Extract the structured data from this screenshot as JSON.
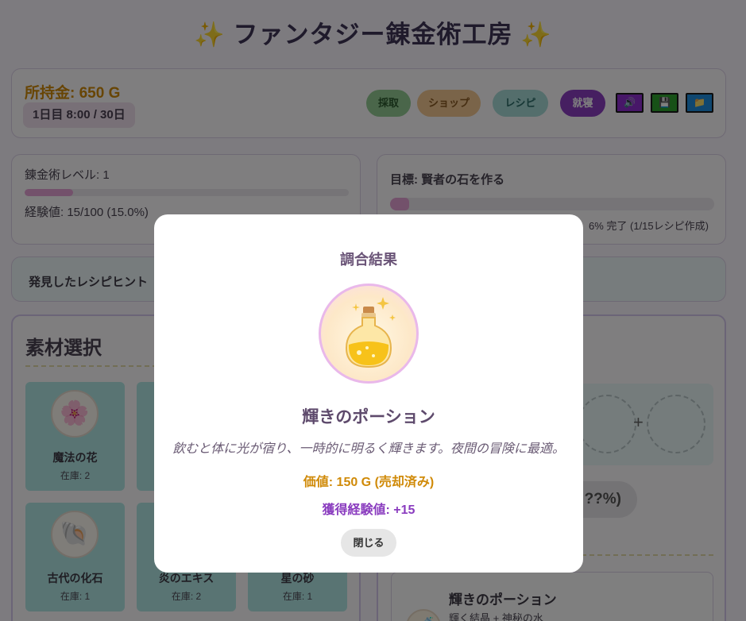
{
  "header": {
    "title": "ファンタジー錬金術工房",
    "sparkle": "✨"
  },
  "status": {
    "gold": "所持金: 650 G",
    "day": "1日目 8:00 / 30日"
  },
  "nav": {
    "gather": "採取",
    "shop": "ショップ",
    "recipe": "レシピ",
    "sleep": "就寝"
  },
  "toolbar": {
    "sound_icon": "speaker-icon",
    "save_icon": "floppy-disk-icon",
    "load_icon": "folder-icon",
    "sound_glyph": "🔊",
    "save_glyph": "💾",
    "load_glyph": "📁"
  },
  "level": {
    "label": "錬金術レベル: 1",
    "exp": "経験値: 15/100 (15.0%)",
    "exp_fraction": 0.15
  },
  "goal": {
    "label": "目標: 賢者の石を作る",
    "progress": "6% 完了 (1/15レシピ作成)",
    "progress_fraction": 0.06
  },
  "hints": {
    "label": "発見したレシピヒント"
  },
  "materials": {
    "heading": "素材選択",
    "items": [
      {
        "name": "魔法の花",
        "stock": "在庫: 2",
        "glyph": "🌸"
      },
      {
        "name": "",
        "stock": "",
        "glyph": ""
      },
      {
        "name": "古代の化石",
        "stock": "在庫: 1",
        "glyph": "🐚"
      },
      {
        "name": "炎のエキス",
        "stock": "在庫: 2",
        "glyph": ""
      },
      {
        "name": "星の砂",
        "stock": "在庫: 1",
        "glyph": ""
      }
    ]
  },
  "mixing": {
    "plus": "+",
    "rate": "??%)"
  },
  "recipe_card": {
    "name": "輝きのポーション",
    "ingredients": "輝く結晶 + 神秘の水",
    "glyph": "🧪"
  },
  "modal": {
    "title": "調合結果",
    "potion_name": "輝きのポーション",
    "description": "飲むと体に光が宿り、一時的に明るく輝きます。夜間の冒険に最適。",
    "value": "価値: 150 G (売却済み)",
    "exp": "獲得経験値: +15",
    "close": "閉じる"
  },
  "colors": {
    "accent": "#8c3fc3",
    "gold": "#d08a08",
    "exp_bar": "#e7a3d6",
    "material_card": "#b3e9e6"
  }
}
